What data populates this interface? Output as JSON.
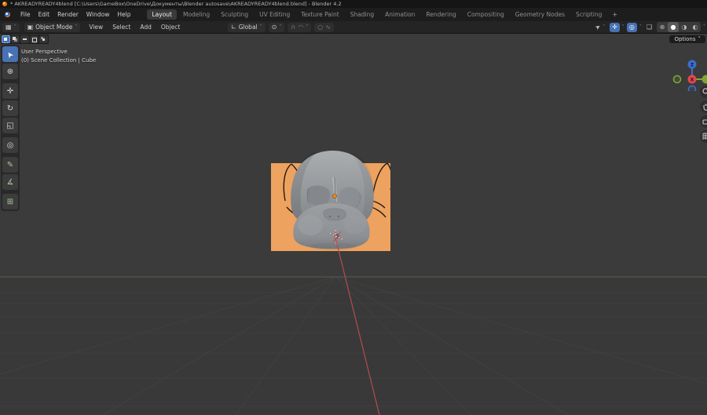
{
  "title_bar": {
    "title": "* AKREADYREADY4blend [C:\\Users\\GameBox\\OneDrive\\Документы\\Blender autosave\\AKREADYREADY4blend.blend] - Blender 4.2"
  },
  "menu_bar": {
    "menus": [
      "File",
      "Edit",
      "Render",
      "Window",
      "Help"
    ],
    "tabs": [
      "Layout",
      "Modeling",
      "Sculpting",
      "UV Editing",
      "Texture Paint",
      "Shading",
      "Animation",
      "Rendering",
      "Compositing",
      "Geometry Nodes",
      "Scripting"
    ],
    "active_tab": "Layout",
    "add_tab_label": "+"
  },
  "viewport_header": {
    "mode": "Object Mode",
    "menus": [
      "View",
      "Select",
      "Add",
      "Object"
    ],
    "orientation": "Global"
  },
  "tool_settings": {
    "options_label": "Options"
  },
  "viewport_overlay": {
    "perspective_label": "User Perspective",
    "collection_label": "(0) Scene Collection | Cube"
  },
  "gizmo": {
    "x_label": "X",
    "z_label": "Z"
  },
  "icons": {
    "editor_type": "▦",
    "caret": "˅",
    "mode_box": "▣",
    "orientation_axis": "∟",
    "pivot": "⊙",
    "magnet": "∩",
    "snap_with": "◠",
    "prop_edit": "○",
    "falloff": "∿",
    "selectability": "➤",
    "gizmo_toggle": "✛",
    "overlays": "◎",
    "xray": "❏",
    "shade_wireframe": "⊕",
    "shade_solid": "●",
    "shade_material": "◑",
    "shade_rendered": "◐",
    "tool_select": "➤",
    "tool_cursor": "⊕",
    "tool_move": "✛",
    "tool_rotate": "↻",
    "tool_scale": "◱",
    "tool_transform": "◎",
    "tool_annotate": "✎",
    "tool_measure": "∡",
    "tool_add_cube": "⊞"
  },
  "colors": {
    "accent_blue": "#4772b3",
    "axis_x_red": "#e0484e",
    "axis_y_green": "#7ca832",
    "axis_z_blue": "#3e6ed0",
    "reference_image_orange": "#eea25f",
    "viewport_bg": "#3b3b3b"
  }
}
